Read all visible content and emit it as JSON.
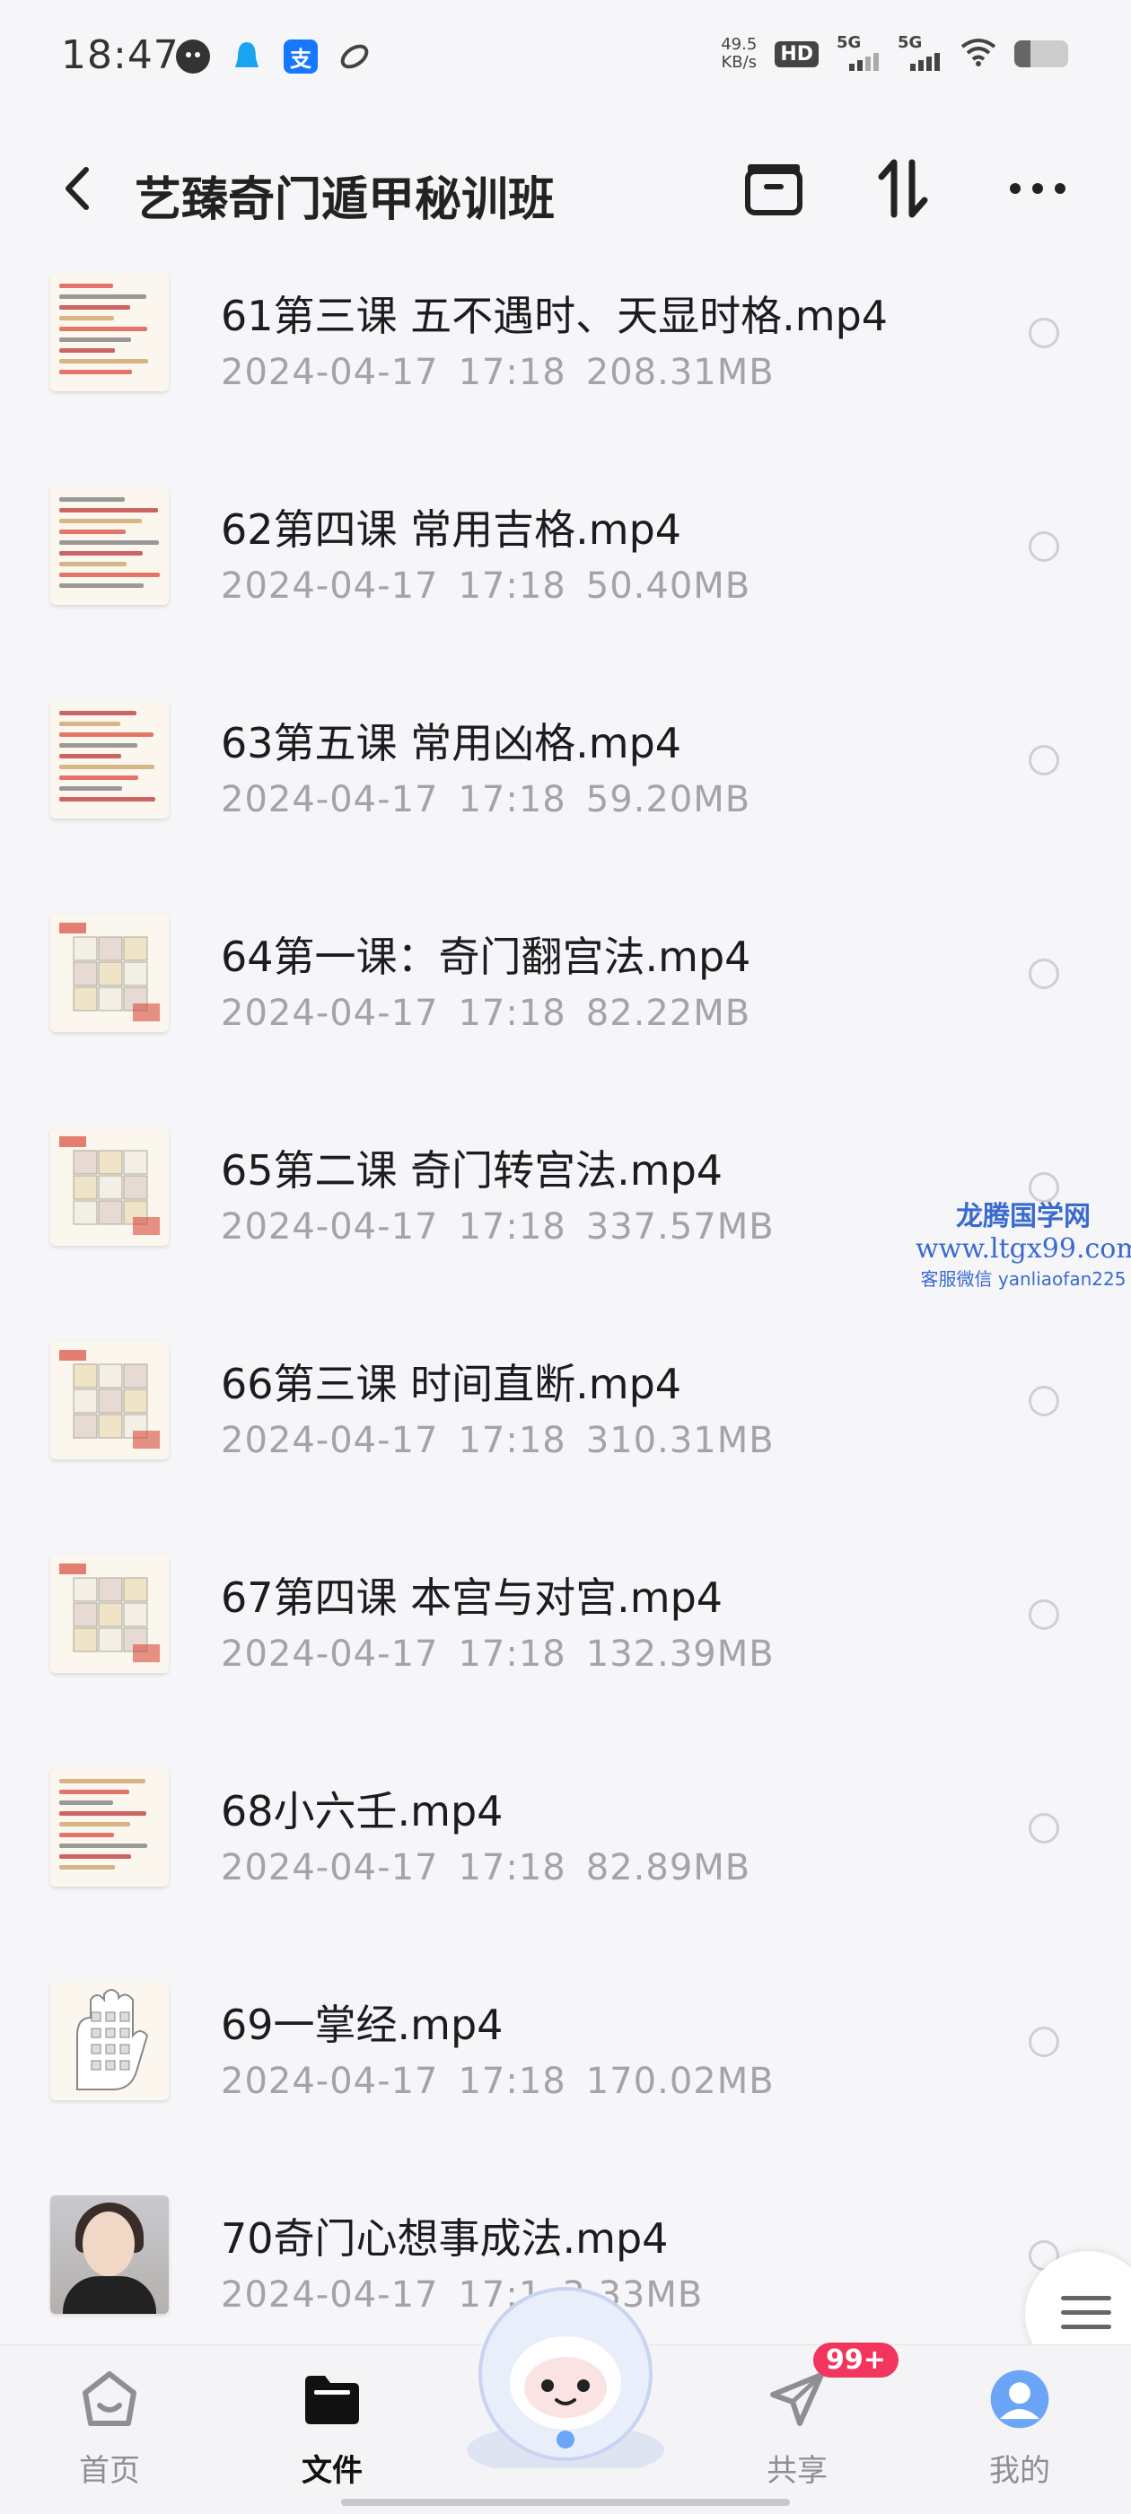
{
  "status_bar": {
    "time": "18:47",
    "net_speed_value": "49.5",
    "net_speed_unit": "KB/s",
    "hd_label": "HD",
    "signal1_label": "5G",
    "signal2_label": "5G",
    "battery_level_percent": 30,
    "icons": [
      "qq-penguin-icon",
      "qq-bell-icon",
      "alipay-icon",
      "app-icon",
      "wifi-icon"
    ]
  },
  "header": {
    "title": "艺臻奇门遁甲秘训班",
    "back_icon": "chevron-left-icon",
    "actions": [
      "archive-icon",
      "sort-icon",
      "more-icon"
    ]
  },
  "files": [
    {
      "name": "61第三课 五不遇时、天显时格.mp4",
      "date": "2024-04-17",
      "time": "17:18",
      "size": "208.31MB",
      "thumb": "text-doc"
    },
    {
      "name": "62第四课 常用吉格.mp4",
      "date": "2024-04-17",
      "time": "17:18",
      "size": "50.40MB",
      "thumb": "text-doc"
    },
    {
      "name": "63第五课 常用凶格.mp4",
      "date": "2024-04-17",
      "time": "17:18",
      "size": "59.20MB",
      "thumb": "text-doc"
    },
    {
      "name": "64第一课：奇门翻宫法.mp4",
      "date": "2024-04-17",
      "time": "17:18",
      "size": "82.22MB",
      "thumb": "grid-chart"
    },
    {
      "name": "65第二课 奇门转宫法.mp4",
      "date": "2024-04-17",
      "time": "17:18",
      "size": "337.57MB",
      "thumb": "grid-chart"
    },
    {
      "name": "66第三课 时间直断.mp4",
      "date": "2024-04-17",
      "time": "17:18",
      "size": "310.31MB",
      "thumb": "grid-chart"
    },
    {
      "name": "67第四课 本宫与对宫.mp4",
      "date": "2024-04-17",
      "time": "17:18",
      "size": "132.39MB",
      "thumb": "grid-chart"
    },
    {
      "name": "68小六壬.mp4",
      "date": "2024-04-17",
      "time": "17:18",
      "size": "82.89MB",
      "thumb": "table-doc"
    },
    {
      "name": "69一掌经.mp4",
      "date": "2024-04-17",
      "time": "17:18",
      "size": "170.02MB",
      "thumb": "hand-chart"
    },
    {
      "name": "70奇门心想事成法.mp4",
      "date": "2024-04-17",
      "time": "17:1",
      "size": "3.33MB",
      "thumb": "photo"
    }
  ],
  "watermark": {
    "title": "龙腾国学网",
    "url": "www.ltgx99.com",
    "contact": "客服微信 yanliaofan225"
  },
  "bottom_nav": {
    "items": [
      {
        "label": "首页",
        "icon": "home-icon",
        "active": false
      },
      {
        "label": "文件",
        "icon": "folder-icon",
        "active": true
      },
      {
        "label": "共享",
        "icon": "paper-plane-icon",
        "active": false
      },
      {
        "label": "我的",
        "icon": "avatar-icon",
        "active": false
      }
    ],
    "share_badge": "99+"
  },
  "colors": {
    "background": "#f6f6f8",
    "text_primary": "#1c1c1e",
    "text_secondary": "#a3a3a8",
    "badge": "#f2355c",
    "watermark": "#3a6ad0",
    "avatar_blue": "#6aa6f5"
  }
}
